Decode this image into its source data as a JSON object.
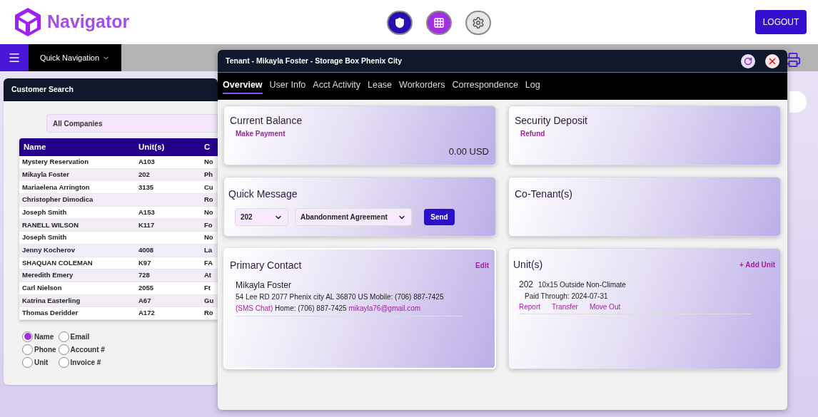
{
  "header": {
    "logo": "Navigator",
    "logout": "LOGOUT"
  },
  "nav": {
    "quick_navigation": "Quick Navigation"
  },
  "customer_search": {
    "title": "Customer Search",
    "company": "All Companies",
    "columns": [
      "Name",
      "Unit(s)",
      "C"
    ],
    "rows": [
      [
        "Mystery Reservation",
        "A103",
        "No"
      ],
      [
        "Mikayla Foster",
        "202",
        "Ph"
      ],
      [
        "Mariaelena Arrington",
        "3135",
        "Cu"
      ],
      [
        "Christopher Dimodica",
        "",
        "Ro"
      ],
      [
        "Joseph Smith",
        "A153",
        "No"
      ],
      [
        "RANELL WILSON",
        "K117",
        "Fo"
      ],
      [
        "Joseph Smith",
        "",
        "No"
      ],
      [
        "Jenny Kocherov",
        "4008",
        "La"
      ],
      [
        "SHAQUAN COLEMAN",
        "K97",
        "FA"
      ],
      [
        "Meredith Emery",
        "728",
        "At"
      ],
      [
        "Carl Nielson",
        "2055",
        "Ft"
      ],
      [
        "Katrina Easterling",
        "A67",
        "Gu"
      ],
      [
        "Thomas Deridder",
        "A172",
        "Ro"
      ]
    ],
    "search_by": [
      {
        "label": "Name",
        "selected": true
      },
      {
        "label": "Email",
        "selected": false
      },
      {
        "label": "Phone",
        "selected": false
      },
      {
        "label": "Account #",
        "selected": false
      },
      {
        "label": "Unit",
        "selected": false
      },
      {
        "label": "Invoice #",
        "selected": false
      }
    ]
  },
  "tenant_window": {
    "title": "Tenant - Mikayla Foster - Storage Box Phenix City",
    "tabs": [
      {
        "label": "Overview",
        "selected": true
      },
      {
        "label": "User Info",
        "selected": false
      },
      {
        "label": "Acct Activity",
        "selected": false
      },
      {
        "label": "Lease",
        "selected": false
      },
      {
        "label": "Workorders",
        "selected": false
      },
      {
        "label": "Correspondence",
        "selected": false
      },
      {
        "label": "Log",
        "selected": false
      }
    ],
    "current_balance": {
      "title": "Current Balance",
      "link": "Make Payment",
      "amount": "0.00 USD"
    },
    "security_deposit": {
      "title": "Security Deposit",
      "link": "Refund"
    },
    "quick_message": {
      "title": "Quick Message",
      "unit": "202",
      "template": "Abandonment Agreement",
      "send": "Send"
    },
    "co_tenants": {
      "title": "Co-Tenant(s)"
    },
    "primary_contact": {
      "title": "Primary Contact",
      "edit": "Edit",
      "name": "Mikayla Foster",
      "details": [
        {
          "kind": "text",
          "text": "54 Lee RD 2077 Phenix city AL 36870 US Mobile: (706) 887-7425 "
        },
        {
          "kind": "link",
          "text": "(SMS Chat)"
        },
        {
          "kind": "text",
          "text": " Home: (706) 887-7425 "
        },
        {
          "kind": "link",
          "text": "mikayla76@gmail.com"
        }
      ]
    },
    "units": {
      "title": "Unit(s)",
      "add": "+ Add Unit",
      "items": [
        {
          "unit": "202",
          "size": "10x15 Outside Non-Climate",
          "paid": "Paid Through: 2024-07-31",
          "actions": [
            "Report",
            "Transfer",
            "Move Out"
          ]
        }
      ]
    }
  }
}
